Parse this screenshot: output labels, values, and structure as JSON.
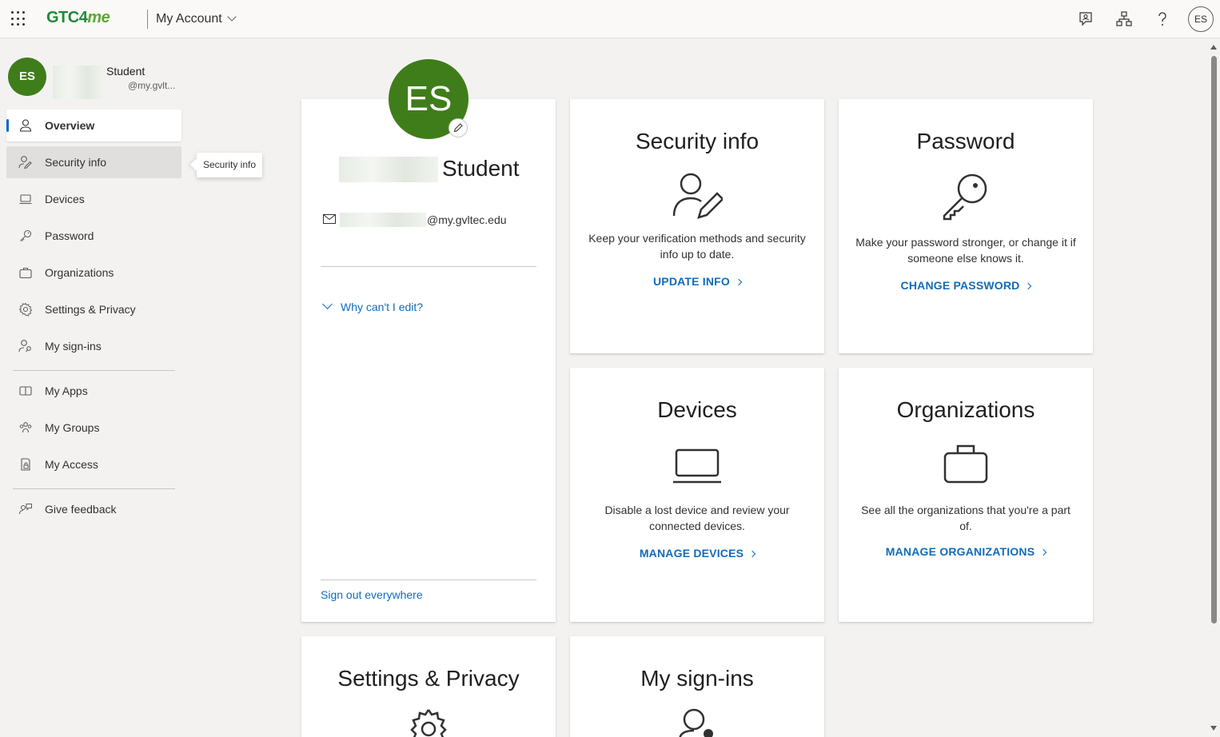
{
  "header": {
    "logo_main": "GTC4",
    "logo_suffix": "me",
    "app_name": "My Account",
    "avatar_initials": "ES",
    "icons": [
      "feedback-icon",
      "organization-chart-icon",
      "help-icon"
    ]
  },
  "sidebar": {
    "avatar_initials": "ES",
    "user_name": "Student",
    "user_email": "@my.gvlt...",
    "items": [
      {
        "label": "Overview",
        "icon": "person-icon"
      },
      {
        "label": "Security info",
        "icon": "person-edit-icon"
      },
      {
        "label": "Devices",
        "icon": "laptop-icon"
      },
      {
        "label": "Password",
        "icon": "key-icon"
      },
      {
        "label": "Organizations",
        "icon": "briefcase-icon"
      },
      {
        "label": "Settings & Privacy",
        "icon": "gear-icon"
      },
      {
        "label": "My sign-ins",
        "icon": "person-key-icon"
      },
      {
        "label": "My Apps",
        "icon": "apps-icon"
      },
      {
        "label": "My Groups",
        "icon": "people-icon"
      },
      {
        "label": "My Access",
        "icon": "lock-doc-icon"
      },
      {
        "label": "Give feedback",
        "icon": "feedback-icon"
      }
    ],
    "tooltip": "Security info"
  },
  "profile": {
    "avatar_initials": "ES",
    "name": "Student",
    "email": "@my.gvltec.edu",
    "why_cant_edit": "Why can't I edit?",
    "sign_out": "Sign out everywhere"
  },
  "cards": {
    "security": {
      "title": "Security info",
      "desc": "Keep your verification methods and security info up to date.",
      "link": "UPDATE INFO"
    },
    "password": {
      "title": "Password",
      "desc": "Make your password stronger, or change it if someone else knows it.",
      "link": "CHANGE PASSWORD"
    },
    "devices": {
      "title": "Devices",
      "desc": "Disable a lost device and review your connected devices.",
      "link": "MANAGE DEVICES"
    },
    "organizations": {
      "title": "Organizations",
      "desc": "See all the organizations that you're a part of.",
      "link": "MANAGE ORGANIZATIONS"
    },
    "settings": {
      "title": "Settings & Privacy"
    },
    "signins": {
      "title": "My sign-ins"
    }
  },
  "colors": {
    "accent": "#0f6cbd",
    "avatar": "#3f7d1a",
    "brand": "#1f8a3a"
  }
}
